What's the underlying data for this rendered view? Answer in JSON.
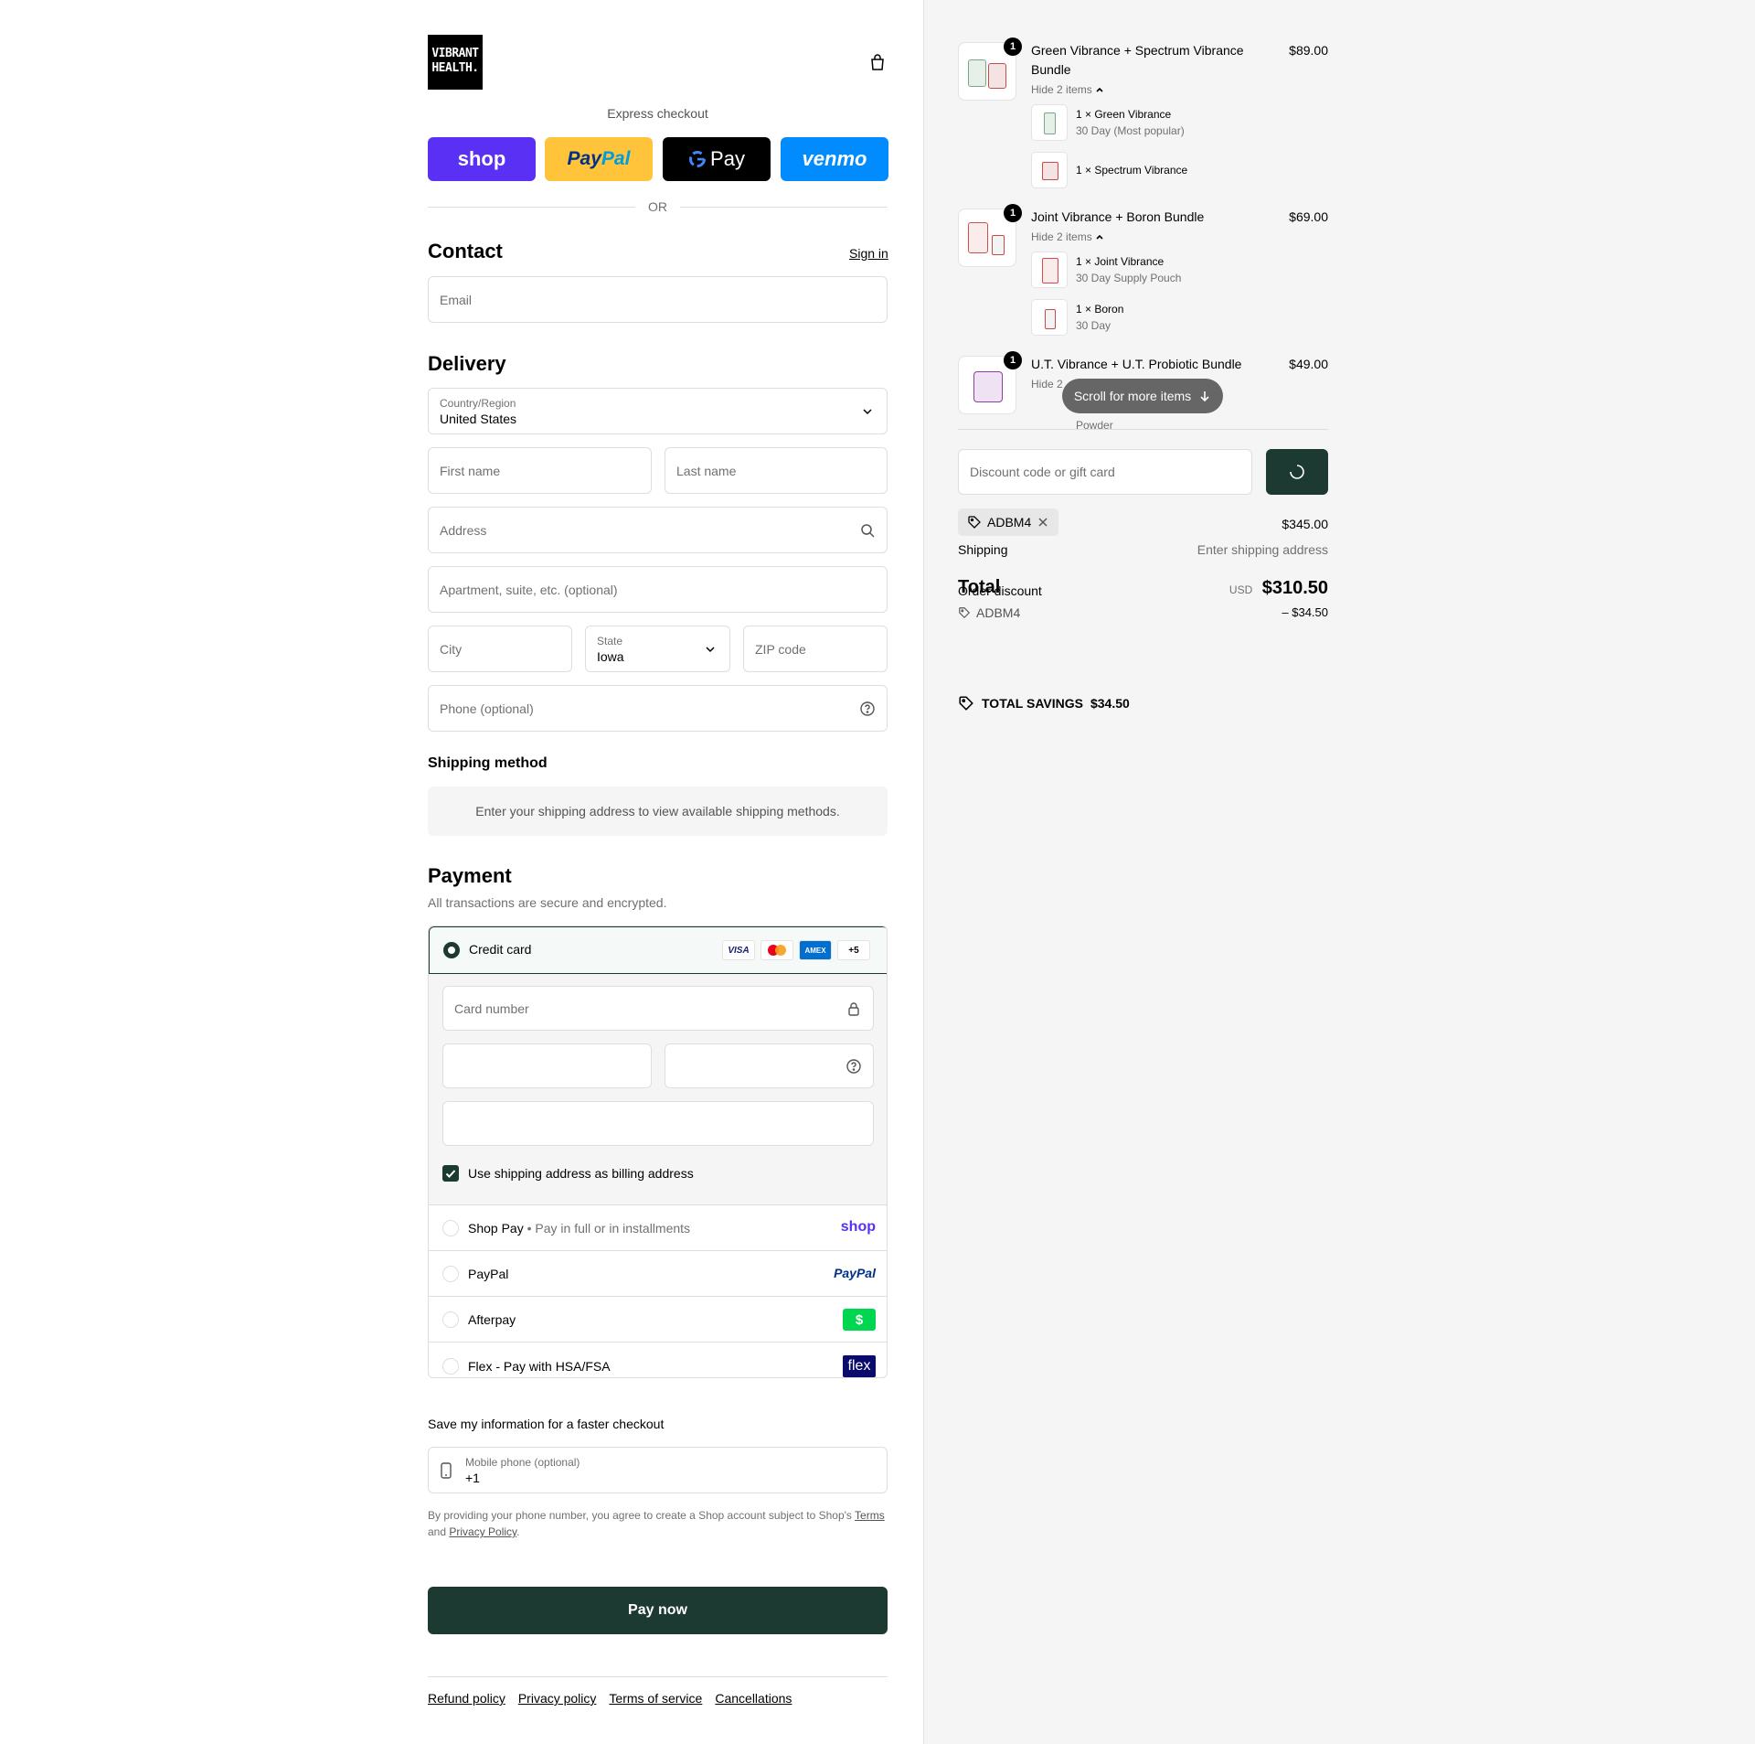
{
  "brand": {
    "logo_text_1": "VIBRANT",
    "logo_text_2": "HEALTH."
  },
  "express": {
    "label": "Express checkout",
    "shop_label": "shop",
    "paypal_label_1": "Pay",
    "paypal_label_2": "Pal",
    "gpay_label": "Pay",
    "venmo_label": "venmo",
    "or_label": "OR"
  },
  "contact": {
    "title": "Contact",
    "sign_in": "Sign in",
    "email_placeholder": "Email"
  },
  "delivery": {
    "title": "Delivery",
    "country_label": "Country/Region",
    "country_value": "United States",
    "first_name_placeholder": "First name",
    "last_name_placeholder": "Last name",
    "address_placeholder": "Address",
    "apartment_placeholder": "Apartment, suite, etc. (optional)",
    "city_placeholder": "City",
    "state_label": "State",
    "state_value": "Iowa",
    "zip_placeholder": "ZIP code",
    "phone_placeholder": "Phone (optional)"
  },
  "shipping_method": {
    "title": "Shipping method",
    "message": "Enter your shipping address to view available shipping methods."
  },
  "payment": {
    "title": "Payment",
    "subtitle": "All transactions are secure and encrypted.",
    "credit_card_label": "Credit card",
    "card_brands": [
      "VISA",
      "MC",
      "AMEX",
      "+5"
    ],
    "card_number_placeholder": "Card number",
    "billing_checkbox_label": "Use shipping address as billing address",
    "options": [
      {
        "label": "Shop Pay",
        "sub": "Pay in full or in installments",
        "logo": "shop"
      },
      {
        "label": "PayPal",
        "sub": "",
        "logo": "PayPal"
      },
      {
        "label": "Afterpay",
        "sub": "",
        "logo": "$"
      },
      {
        "label": "Flex - Pay with HSA/FSA",
        "sub": "",
        "logo": "flex"
      }
    ]
  },
  "save_info": {
    "title": "Save my information for a faster checkout",
    "mobile_label": "Mobile phone (optional)",
    "mobile_value": "+1",
    "legal_1": "By providing your phone number, you agree to create a Shop account subject to Shop's",
    "terms": "Terms",
    "and": "and",
    "privacy": "Privacy Policy",
    "period": "."
  },
  "pay_now": "Pay now",
  "footer_links": [
    "Refund policy",
    "Privacy policy",
    "Terms of service",
    "Cancellations"
  ],
  "order": {
    "items": [
      {
        "qty": "1",
        "title_1": "Green Vibrance + Spectrum Vibrance",
        "title_2": "Bundle",
        "price": "$89.00",
        "toggle": "Hide 2 items",
        "sub": [
          {
            "name": "1 × Green Vibrance",
            "variant": "30 Day (Most popular)"
          },
          {
            "name": "1 × Spectrum Vibrance",
            "variant": ""
          }
        ]
      },
      {
        "qty": "1",
        "title_1": "Joint Vibrance + Boron Bundle",
        "price": "$69.00",
        "toggle": "Hide 2 items",
        "sub": [
          {
            "name": "1 × Joint Vibrance",
            "variant": "30 Day Supply Pouch"
          },
          {
            "name": "1 × Boron",
            "variant": "30 Day"
          }
        ]
      },
      {
        "qty": "1",
        "title_1": "U.T. Vibrance + U.T. Probiotic Bundle",
        "price": "$49.00",
        "toggle": "Hide 2",
        "sub_partial": "Powder"
      }
    ],
    "scroll_hint": "Scroll for more items",
    "discount_placeholder": "Discount code or gift card",
    "applied_code": "ADBM4",
    "subtotal": "$345.00",
    "shipping_label": "Shipping",
    "shipping_value": "Enter shipping address",
    "total_label": "Total",
    "order_discount_label": "Order discount",
    "currency": "USD",
    "total": "$310.50",
    "discount_code": "ADBM4",
    "discount_amount": "– $34.50",
    "savings_label": "TOTAL SAVINGS",
    "savings_value": "$34.50"
  },
  "colors": {
    "primary": "#1c3a32",
    "shop": "#5a31f4",
    "paypal": "#ffc439",
    "venmo": "#008cff",
    "afterpay_green": "#00d64f",
    "flex_navy": "#0b0b6e"
  }
}
